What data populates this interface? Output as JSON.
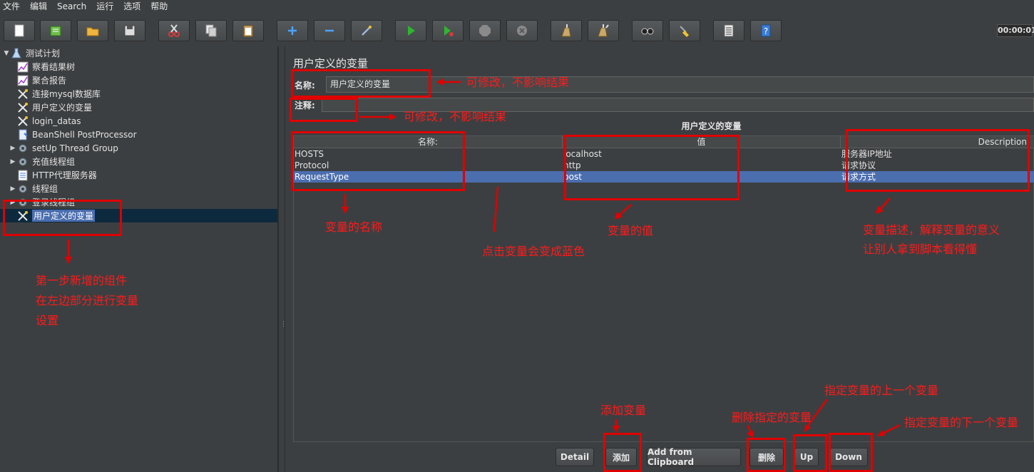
{
  "menu": [
    "文件",
    "编辑",
    "Search",
    "运行",
    "选项",
    "帮助"
  ],
  "toolbar": {
    "timer": "00:00:01",
    "buttons": [
      {
        "icon": "new-icon",
        "color": "#ffffff"
      },
      {
        "icon": "templates-icon",
        "color": "#6fbf4a"
      },
      {
        "icon": "open-icon",
        "color": "#f0b540"
      },
      {
        "icon": "save-icon",
        "color": "#dddddd"
      },
      {
        "icon": "cut-icon",
        "color": "#d23b3b"
      },
      {
        "icon": "copy-icon",
        "color": "#e8e8e8"
      },
      {
        "icon": "paste-icon",
        "color": "#e8e8e8"
      },
      {
        "icon": "expand-icon",
        "color": "#4aa3ff"
      },
      {
        "icon": "collapse-icon",
        "color": "#4aa3ff"
      },
      {
        "icon": "toggle-icon",
        "color": "#9fb7d8"
      },
      {
        "icon": "start-icon",
        "color": "#2fb52f"
      },
      {
        "icon": "start-no-pause-icon",
        "color": "#2fb52f"
      },
      {
        "icon": "stop-icon",
        "color": "#8a8a8a"
      },
      {
        "icon": "shutdown-icon",
        "color": "#8a8a8a"
      },
      {
        "icon": "clear-icon",
        "color": "#c9a86b"
      },
      {
        "icon": "clear-all-icon",
        "color": "#c9a86b"
      },
      {
        "icon": "search-icon",
        "color": "#cccccc"
      },
      {
        "icon": "reset-search-icon",
        "color": "#f2c230"
      },
      {
        "icon": "function-helper-icon",
        "color": "#eeeeee"
      },
      {
        "icon": "help-icon",
        "color": "#3b7dd8"
      }
    ]
  },
  "tree": {
    "items": [
      {
        "label": "测试计划",
        "icon": "test-plan-icon",
        "toggle": "▼"
      },
      {
        "label": "察看结果树",
        "icon": "listener-icon",
        "toggle": ""
      },
      {
        "label": "聚合报告",
        "icon": "listener-icon",
        "toggle": ""
      },
      {
        "label": "连接mysql数据库",
        "icon": "config-element-icon",
        "toggle": ""
      },
      {
        "label": "用户定义的变量",
        "icon": "config-element-icon",
        "toggle": ""
      },
      {
        "label": "login_datas",
        "icon": "config-element-icon",
        "toggle": ""
      },
      {
        "label": "BeanShell PostProcessor",
        "icon": "postprocessor-icon",
        "toggle": ""
      },
      {
        "label": "setUp Thread Group",
        "icon": "thread-group-icon",
        "toggle": "▶"
      },
      {
        "label": "充值线程组",
        "icon": "thread-group-icon",
        "toggle": "▶"
      },
      {
        "label": "HTTP代理服务器",
        "icon": "proxy-server-icon",
        "toggle": ""
      },
      {
        "label": "线程组",
        "icon": "thread-group-icon",
        "toggle": "▶"
      },
      {
        "label": "登录线程组",
        "icon": "thread-group-icon",
        "toggle": "▶"
      },
      {
        "label": "用户定义的变量",
        "icon": "config-element-icon",
        "toggle": ""
      }
    ]
  },
  "panel": {
    "title": "用户定义的变量",
    "name_label": "名称:",
    "name_value": "用户定义的变量",
    "comment_label": "注释:",
    "comment_value": "",
    "table_caption": "用户定义的变量",
    "columns": [
      "名称:",
      "值",
      "Description"
    ],
    "rows": [
      {
        "name": "HOSTS",
        "value": "localhost",
        "description": "服务器IP地址"
      },
      {
        "name": "Protocol",
        "value": "http",
        "description": "请求协议"
      },
      {
        "name": "RequestType",
        "value": "post",
        "description": "请求方式"
      }
    ],
    "selected_row": 2,
    "buttons": {
      "detail": "Detail",
      "add": "添加",
      "add_clipboard": "Add from Clipboard",
      "delete": "删除",
      "up": "Up",
      "down": "Down"
    }
  },
  "annotations": {
    "name_note": "可修改，不影响结果",
    "comment_note": "可修改，不影响结果",
    "col_name_note": "变量的名称",
    "click_note": "点击变量会变成蓝色",
    "col_value_note": "变量的值",
    "col_desc_note_1": "变量描述，解释变量的意义",
    "col_desc_note_2": "让别人拿到脚本看得懂",
    "left_note_1": "第一步新增的组件",
    "left_note_2": "在左边部分进行变量",
    "left_note_3": "设置",
    "add_note": "添加变量",
    "delete_note": "删除指定的变量",
    "up_note": "指定变量的上一个变量",
    "down_note": "指定变量的下一个变量",
    "color": "#e00000"
  }
}
